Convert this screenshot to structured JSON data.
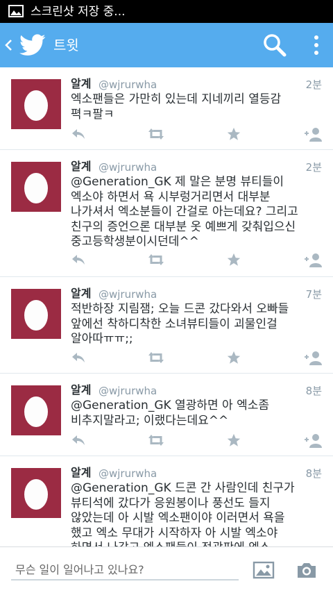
{
  "status_bar": {
    "text": "스크린샷 저장 중...",
    "icon": "image-icon"
  },
  "app_bar": {
    "title": "트윗",
    "back_icon": "back-chevron-icon",
    "logo_icon": "twitter-bird-icon",
    "search_icon": "search-icon",
    "menu_icon": "overflow-menu-icon",
    "color": "#55acee"
  },
  "tweets": [
    {
      "name": "알계",
      "handle": "@wjrurwha",
      "time": "2분",
      "text": "엑소팬들은 가만히 있는데 지네끼리 열등감\n펵ㅋ팔ㅋ"
    },
    {
      "name": "알계",
      "handle": "@wjrurwha",
      "time": "2분",
      "text": "@Generation_GK 제 말은 분명 뷰티들이\n엑소야 하면서 욕 시부렁거리면서 대부분\n나가셔서 엑소분들이 간걸로 아는데요? 그리고\n친구의 증언으론 대부분 옷 예쁘게 갖춰입으신\n중고등학생분이시던데^^"
    },
    {
      "name": "알계",
      "handle": "@wjrurwha",
      "time": "7분",
      "text": "적반하장 지림잼; 오늘 드콘 갔다와서 오빠들\n앞에선 착하디착한 소녀뷰티들이 괴물인걸\n알아따ㅠㅠ;;"
    },
    {
      "name": "알계",
      "handle": "@wjrurwha",
      "time": "8분",
      "text": "@Generation_GK 열광하면 아 엑소좀\n비추지말라고; 이랬다는데요^^"
    },
    {
      "name": "알계",
      "handle": "@wjrurwha",
      "time": "8분",
      "text": "@Generation_GK 드콘 간 사람인데 친구가\n뷰티석에 갔다가 응원봉이나 풍선도 들지\n않았는데 아 시발 엑소팬이야 이러면서 욕을\n했고 엑소 무대가 시작하자 아 시발 엑소야\n하면서 나갔고 엑소팬들이 전광판에 엑소"
    }
  ],
  "composer": {
    "placeholder": "무슨 일이 일어나고 있나요?",
    "photo_icon": "photo-icon",
    "camera_icon": "camera-icon"
  },
  "colors": {
    "avatar_bg": "#9b2b43",
    "icon_gray": "#aab8c2",
    "text_gray": "#8899a6"
  }
}
